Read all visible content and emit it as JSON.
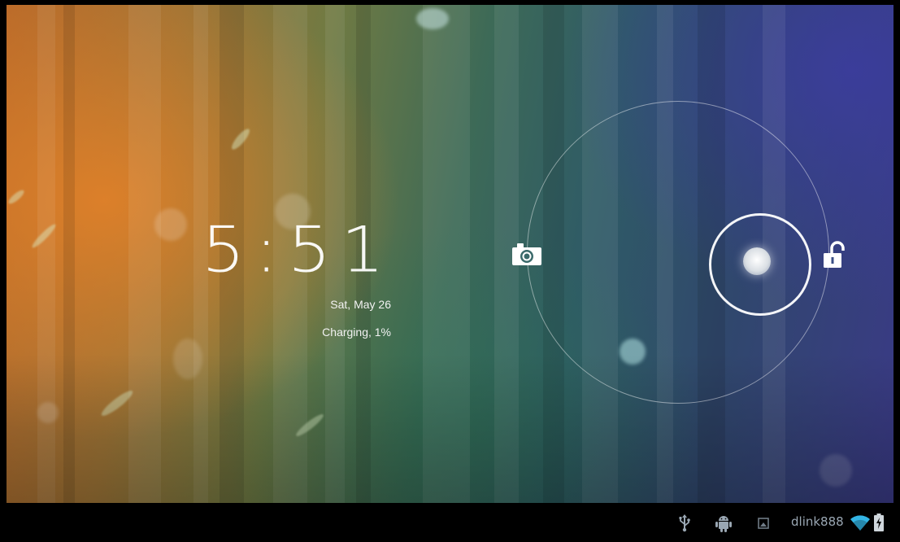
{
  "lockscreen": {
    "time": "5:51",
    "date": "Sat, May 26",
    "charging_status": "Charging, 1%"
  },
  "unlock_widget": {
    "left_target_icon": "camera-icon",
    "right_target_icon": "unlock-icon",
    "handle_icon": "unlock-handle"
  },
  "status_bar": {
    "icons": [
      "usb-icon",
      "android-debug-icon",
      "notification-icon"
    ],
    "wifi_name": "dlink888",
    "wifi_icon": "wifi-icon",
    "battery_icon": "battery-charging-icon",
    "colors": {
      "text": "#9aa7b3",
      "wifi": "#33b5e5",
      "background": "#000000"
    }
  }
}
